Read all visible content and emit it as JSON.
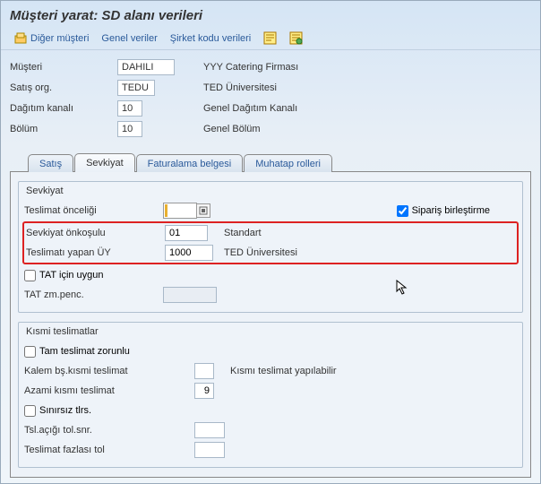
{
  "title": "Müşteri yarat: SD alanı verileri",
  "toolbar": {
    "other_customer": "Diğer müşteri",
    "general_data": "Genel veriler",
    "company_code_data": "Şirket kodu verileri"
  },
  "header": {
    "customer_label": "Müşteri",
    "customer_value": "DAHILI",
    "customer_desc": "YYY Catering Firması",
    "sales_org_label": "Satış org.",
    "sales_org_value": "TEDU",
    "sales_org_desc": "TED Üniversitesi",
    "dist_channel_label": "Dağıtım kanalı",
    "dist_channel_value": "10",
    "dist_channel_desc": "Genel Dağıtım Kanalı",
    "division_label": "Bölüm",
    "division_value": "10",
    "division_desc": "Genel Bölüm"
  },
  "tabs": {
    "sales": "Satış",
    "shipping": "Sevkiyat",
    "billing": "Faturalama belgesi",
    "partner": "Muhatap rolleri"
  },
  "shipping": {
    "box_title": "Sevkiyat",
    "priority_label": "Teslimat önceliği",
    "order_combine_label": "Sipariş birleştirme",
    "ship_cond_label": "Sevkiyat önkoşulu",
    "ship_cond_value": "01",
    "ship_cond_desc": "Standart",
    "deliv_plant_label": "Teslimatı yapan ÜY",
    "deliv_plant_value": "1000",
    "deliv_plant_desc": "TED Üniversitesi",
    "tat_suitable_label": "TAT için uygun",
    "tat_window_label": "TAT zm.penc."
  },
  "partial": {
    "box_title": "Kısmi teslimatlar",
    "complete_label": "Tam teslimat zorunlu",
    "item_partial_label": "Kalem bş.kısmi teslimat",
    "item_partial_desc": "Kısmı teslimat yapılabilir",
    "max_partial_label": "Azami kısmı teslimat",
    "max_partial_value": "9",
    "unlimited_label": "Sınırsız tlrs.",
    "under_tol_label": "Tsl.açığı tol.snr.",
    "over_tol_label": "Teslimat fazlası tol"
  }
}
